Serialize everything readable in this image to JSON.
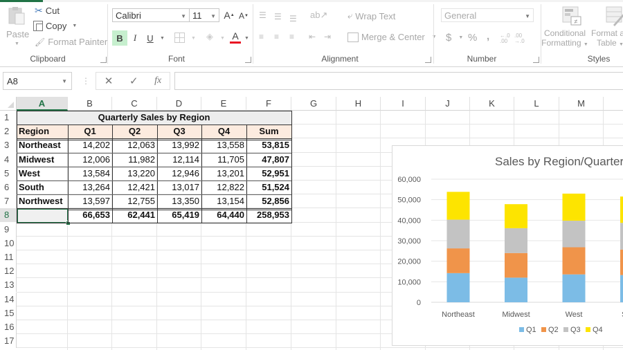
{
  "ribbon": {
    "clipboard": {
      "paste_label": "Paste",
      "cut_label": "Cut",
      "copy_label": "Copy",
      "format_painter_label": "Format Painter",
      "group_label": "Clipboard"
    },
    "font": {
      "font_name": "Calibri",
      "font_size": "11",
      "bold_label": "B",
      "italic_label": "I",
      "underline_label": "U",
      "font_color": "#e81123",
      "group_label": "Font"
    },
    "alignment": {
      "wrap_text_label": "Wrap Text",
      "merge_center_label": "Merge & Center",
      "group_label": "Alignment"
    },
    "number": {
      "format_value": "General",
      "currency_label": "$",
      "percent_label": "%",
      "comma_label": ",",
      "group_label": "Number"
    },
    "styles": {
      "conditional_formatting_label_1": "Conditional",
      "conditional_formatting_label_2": "Formatting",
      "format_as_table_label_1": "Format as",
      "format_as_table_label_2": "Table",
      "group_label": "Styles"
    }
  },
  "formula_bar": {
    "name_box": "A8",
    "cancel_icon": "✕",
    "enter_icon": "✓",
    "fx_label": "fx",
    "formula_value": ""
  },
  "sheet": {
    "columns": [
      "A",
      "B",
      "C",
      "D",
      "E",
      "F",
      "G",
      "H",
      "I",
      "J",
      "K",
      "L",
      "M"
    ],
    "rows": [
      "1",
      "2",
      "3",
      "4",
      "5",
      "6",
      "7",
      "8",
      "9",
      "10",
      "11",
      "12",
      "13",
      "14",
      "15",
      "16",
      "17"
    ],
    "selected_cell": "A8",
    "table_title": "Quarterly Sales by Region",
    "headers": [
      "Region",
      "Q1",
      "Q2",
      "Q3",
      "Q4",
      "Sum"
    ],
    "data": [
      [
        "Northeast",
        "14,202",
        "12,063",
        "13,992",
        "13,558",
        "53,815"
      ],
      [
        "Midwest",
        "12,006",
        "11,982",
        "12,114",
        "11,705",
        "47,807"
      ],
      [
        "West",
        "13,584",
        "13,220",
        "12,946",
        "13,201",
        "52,951"
      ],
      [
        "South",
        "13,264",
        "12,421",
        "13,017",
        "12,822",
        "51,524"
      ],
      [
        "Northwest",
        "13,597",
        "12,755",
        "13,350",
        "13,154",
        "52,856"
      ]
    ],
    "totals": [
      "",
      "66,653",
      "62,441",
      "65,419",
      "64,440",
      "258,953"
    ]
  },
  "chart_data": {
    "type": "bar",
    "stacked": true,
    "title": "Sales by Region/Quarter",
    "categories": [
      "Northeast",
      "Midwest",
      "West",
      "South"
    ],
    "series": [
      {
        "name": "Q1",
        "color": "#7cbce6",
        "values": [
          14202,
          12006,
          13584,
          13264
        ]
      },
      {
        "name": "Q2",
        "color": "#f0944a",
        "values": [
          12063,
          11982,
          13220,
          12421
        ]
      },
      {
        "name": "Q3",
        "color": "#c3c3c3",
        "values": [
          13992,
          12114,
          12946,
          13017
        ]
      },
      {
        "name": "Q4",
        "color": "#fde400",
        "values": [
          13558,
          11705,
          13201,
          12822
        ]
      }
    ],
    "yticks": [
      "0",
      "10,000",
      "20,000",
      "30,000",
      "40,000",
      "50,000",
      "60,000"
    ],
    "ylim": [
      0,
      60000
    ],
    "xlabel": "",
    "ylabel": "",
    "grid": true,
    "legend": "bottom"
  }
}
